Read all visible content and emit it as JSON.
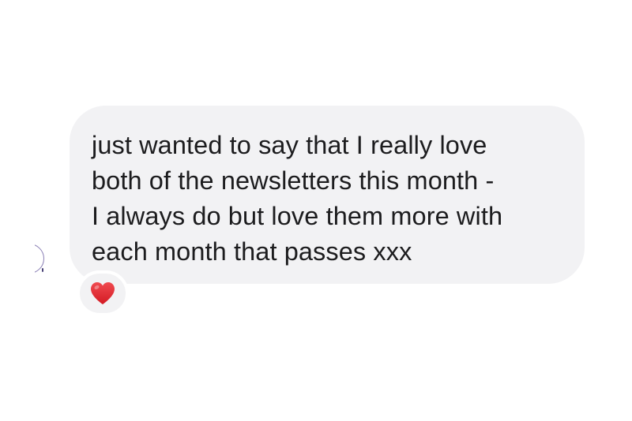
{
  "conversation": {
    "message": {
      "lines": [
        "just wanted to say that I really love",
        "both of the newsletters this month -",
        "I always do but love them more with",
        "each month that passes xxx"
      ],
      "reaction": {
        "icon": "red-heart-icon",
        "color": "#e0232e"
      }
    }
  },
  "colors": {
    "bubble": "#f2f2f4",
    "text": "#1c1c1e",
    "background": "#ffffff"
  }
}
